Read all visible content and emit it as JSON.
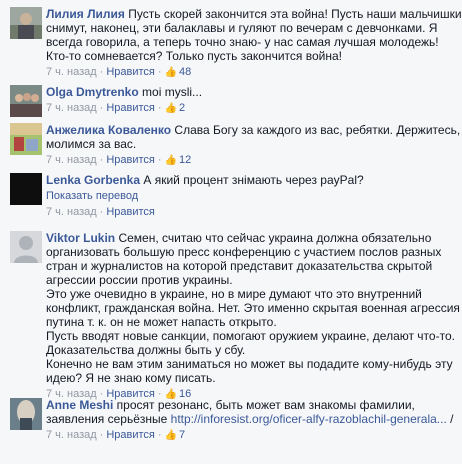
{
  "comments": [
    {
      "name": "Лилия Лилия",
      "text": " Пусть скорей закончится эта война! Пусть наши мальчишки снимут, наконец, эти балаклавы и гуляют по вечерам с девчонками. Я всегда говорила, а теперь точно знаю- у нас самая лучшая молодежь! Кто-то сомневается? Только пусть закончится война!",
      "time": "7 ч. назад",
      "like_label": "Нравится",
      "likes": "48"
    },
    {
      "name": "Olga Dmytrenko",
      "text": " moi mysli...",
      "time": "7 ч. назад",
      "like_label": "Нравится",
      "likes": "2"
    },
    {
      "name": "Анжелика Коваленко",
      "text": " Слава Богу за каждого из вас, ребятки. Держитесь, молимся за вас.",
      "time": "7 ч. назад",
      "like_label": "Нравится",
      "likes": "12"
    },
    {
      "name": "Lenka Gorbenka",
      "text": " А який процент знімають через payPal?",
      "translate": "Показать перевод",
      "time": "7 ч. назад",
      "like_label": "Нравится"
    },
    {
      "name": "Viktor Lukin",
      "text_lines": [
        " Семен, считаю что сейчас украина должна обязательно организовать большую пресс конференцию с участием послов разных стран и журналистов на которой представит доказательства скрытой агрессии россии против украины.",
        "Это уже очевидно в украине, но в мире думают что это внутренний конфликт, гражданская война. Нет. Это именно скрытая военная агрессия путина т. к. он не может напасть открыто.",
        "Пусть вводят новые санкции, помогают оружием украине, делают что-то. Доказательства должны быть у сбу.",
        "Конечно не вам этим заниматься но может вы подадите кому-нибудь эту идею? Я не знаю кому писать."
      ],
      "time": "7 ч. назад",
      "like_label": "Нравится",
      "likes": "16"
    },
    {
      "name": "Anne Meshi",
      "text": " просят резонанс, быть может вам знакомы фамилии, заявления серьёзные ",
      "link": "http://inforesist.org/oficer-alfy-razoblachil-generala...",
      "link_suffix": " /",
      "time": "7 ч. назад",
      "like_label": "Нравится",
      "likes": "7"
    }
  ],
  "icons": {
    "like": "thumbs-up-icon"
  },
  "colors": {
    "name": "#3b5998",
    "meta": "#9197a3",
    "background": "#f6f7f9"
  }
}
